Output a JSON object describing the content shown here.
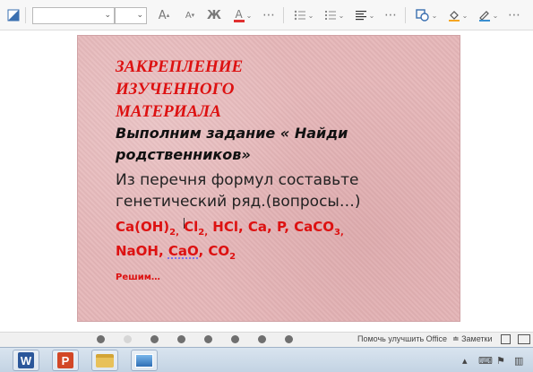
{
  "toolbar": {
    "font_name_value": "",
    "font_size_value": "",
    "grow_font_glyph": "A",
    "shrink_font_glyph": "A",
    "bold_glyph": "Ж",
    "font_color_glyph": "A"
  },
  "slide": {
    "heading": "ЗАКРЕПЛЕНИЕ\nИЗУЧЕННОГО\nМАТЕРИАЛА",
    "task": "Выполним задание « Найди\nродственников»",
    "instruction": "Из перечня формул составьте\nгенетический ряд.(вопросы…)",
    "formula_line1": {
      "p1": "Ca(OH)",
      "p1_sub": "2,",
      "p2": " Cl",
      "p2_sub": "2,",
      "p3": " HCl, Ca, P, CaCO",
      "p3_sub": "3,"
    },
    "formula_line2": {
      "p1": "NaOH, ",
      "p2": "CaO",
      "p3": ", CO",
      "p3_sub": "2"
    },
    "solve": "Решим…"
  },
  "statusbar": {
    "improve_office": "Помочь улучшить Office",
    "notes": "Заметки"
  },
  "taskbar": {
    "word_letter": "W",
    "ppt_letter": "P"
  }
}
